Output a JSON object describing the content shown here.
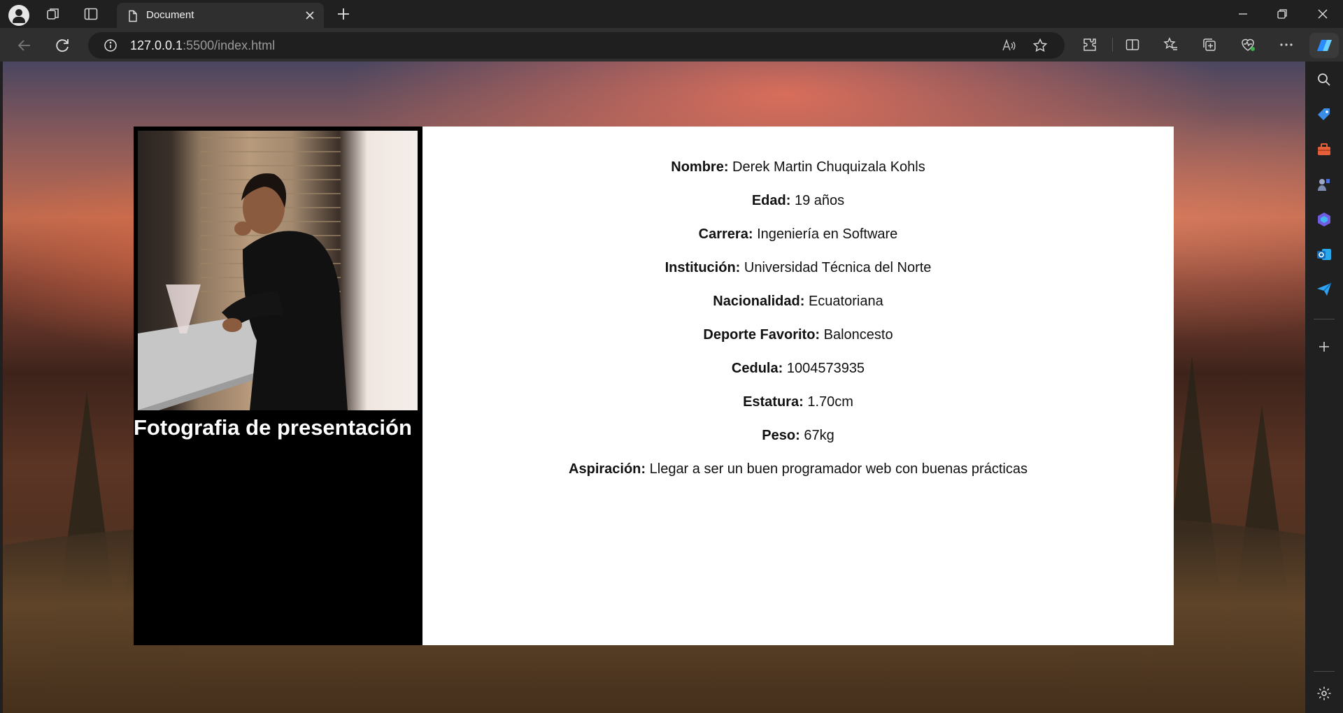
{
  "browser": {
    "tab_title": "Document",
    "url_host": "127.0.0.1",
    "url_path": ":5500/index.html"
  },
  "icons": {
    "tabbar": [
      "profile-icon",
      "workspaces-icon",
      "vertical-tabs-icon",
      "document-icon",
      "close-icon",
      "plus-icon"
    ],
    "window": [
      "minimize-icon",
      "restore-icon",
      "close-window-icon"
    ],
    "nav": [
      "back-icon",
      "refresh-icon",
      "info-icon",
      "read-aloud-icon",
      "favorite-star-icon"
    ],
    "toolbar": [
      "extensions-icon",
      "split-screen-icon",
      "favorites-icon",
      "collections-icon",
      "browser-essentials-icon",
      "more-icon",
      "copilot-icon"
    ],
    "sidebar": [
      "search-icon",
      "shopping-icon",
      "tools-icon",
      "games-icon",
      "microsoft-365-icon",
      "outlook-icon",
      "send-icon",
      "add-icon",
      "settings-icon"
    ]
  },
  "page": {
    "photo_caption": "Fotografia de presentación",
    "fields": [
      {
        "label": "Nombre:",
        "value": "Derek Martin Chuquizala Kohls"
      },
      {
        "label": "Edad:",
        "value": "19 años"
      },
      {
        "label": "Carrera:",
        "value": "Ingeniería en Software"
      },
      {
        "label": "Institución:",
        "value": "Universidad Técnica del Norte"
      },
      {
        "label": "Nacionalidad:",
        "value": "Ecuatoriana"
      },
      {
        "label": "Deporte Favorito:",
        "value": "Baloncesto"
      },
      {
        "label": "Cedula:",
        "value": "1004573935"
      },
      {
        "label": "Estatura:",
        "value": "1.70cm"
      },
      {
        "label": "Peso:",
        "value": "67kg"
      },
      {
        "label": "Aspiración:",
        "value": "Llegar a ser un buen programador web con buenas prácticas"
      }
    ]
  },
  "colors": {
    "chrome_dark": "#202020",
    "chrome_mid": "#2f2f2f",
    "card_left": "#000000",
    "card_right": "#ffffff",
    "copilot_accent": "#2a8cff"
  }
}
